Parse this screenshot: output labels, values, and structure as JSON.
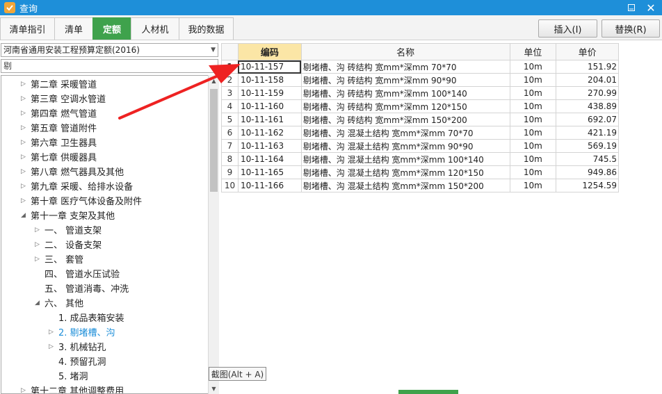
{
  "window": {
    "title": "查询"
  },
  "tabs": [
    {
      "label": "清单指引"
    },
    {
      "label": "清单"
    },
    {
      "label": "定额"
    },
    {
      "label": "人材机"
    },
    {
      "label": "我的数据"
    }
  ],
  "actions": {
    "insert_label": "插入(I)",
    "replace_label": "替换(R)"
  },
  "left": {
    "dropdown_value": "河南省通用安装工程预算定额(2016)",
    "search_value": "剔",
    "tree": [
      {
        "label": "第二章  采暖管道"
      },
      {
        "label": "第三章  空调水管道"
      },
      {
        "label": "第四章  燃气管道"
      },
      {
        "label": "第五章  管道附件"
      },
      {
        "label": "第六章  卫生器具"
      },
      {
        "label": "第七章  供暖器具"
      },
      {
        "label": "第八章  燃气器具及其他"
      },
      {
        "label": "第九章  采暖、给排水设备"
      },
      {
        "label": "第十章  医疗气体设备及附件"
      },
      {
        "label": "第十一章  支架及其他"
      },
      {
        "label": "一、  管道支架"
      },
      {
        "label": "二、  设备支架"
      },
      {
        "label": "三、  套管"
      },
      {
        "label": "四、  管道水压试验"
      },
      {
        "label": "五、  管道消毒、冲洗"
      },
      {
        "label": "六、  其他"
      },
      {
        "label": "1.  成品表箱安装"
      },
      {
        "label": "2.  剔堵槽、沟"
      },
      {
        "label": "3.  机械钻孔"
      },
      {
        "label": "4.  预留孔洞"
      },
      {
        "label": "5.  堵洞"
      },
      {
        "label": "第十二章  其他调整费用"
      }
    ]
  },
  "tooltip": "截图(Alt + A)",
  "grid": {
    "headers": {
      "code": "编码",
      "name": "名称",
      "unit": "单位",
      "price": "单价"
    },
    "rows": [
      {
        "num": "1",
        "code": "10-11-157",
        "name": "剔堵槽、沟 砖结构 宽mm*深mm 70*70",
        "unit": "10m",
        "price": "151.92"
      },
      {
        "num": "2",
        "code": "10-11-158",
        "name": "剔堵槽、沟 砖结构 宽mm*深mm 90*90",
        "unit": "10m",
        "price": "204.01"
      },
      {
        "num": "3",
        "code": "10-11-159",
        "name": "剔堵槽、沟 砖结构 宽mm*深mm 100*140",
        "unit": "10m",
        "price": "270.99"
      },
      {
        "num": "4",
        "code": "10-11-160",
        "name": "剔堵槽、沟 砖结构 宽mm*深mm 120*150",
        "unit": "10m",
        "price": "438.89"
      },
      {
        "num": "5",
        "code": "10-11-161",
        "name": "剔堵槽、沟 砖结构 宽mm*深mm 150*200",
        "unit": "10m",
        "price": "692.07"
      },
      {
        "num": "6",
        "code": "10-11-162",
        "name": "剔堵槽、沟 混凝土结构 宽mm*深mm 70*70",
        "unit": "10m",
        "price": "421.19"
      },
      {
        "num": "7",
        "code": "10-11-163",
        "name": "剔堵槽、沟 混凝土结构 宽mm*深mm 90*90",
        "unit": "10m",
        "price": "569.19"
      },
      {
        "num": "8",
        "code": "10-11-164",
        "name": "剔堵槽、沟 混凝土结构 宽mm*深mm 100*140",
        "unit": "10m",
        "price": "745.5"
      },
      {
        "num": "9",
        "code": "10-11-165",
        "name": "剔堵槽、沟 混凝土结构 宽mm*深mm 120*150",
        "unit": "10m",
        "price": "949.86"
      },
      {
        "num": "10",
        "code": "10-11-166",
        "name": "剔堵槽、沟 混凝土结构 宽mm*深mm 150*200",
        "unit": "10m",
        "price": "1254.59"
      }
    ]
  },
  "colors": {
    "titlebar": "#1e8fd9",
    "active_tab": "#3fa24c",
    "highlight_header": "#fbe6a6",
    "selected_tree": "#1e8fd9",
    "annotation_arrow": "#ee2222"
  },
  "icons": [
    "app-logo-icon",
    "minimize-icon",
    "close-icon",
    "chevron-down-icon",
    "tree-expand-icon",
    "tree-collapse-icon",
    "scroll-up-icon",
    "scroll-down-icon"
  ]
}
